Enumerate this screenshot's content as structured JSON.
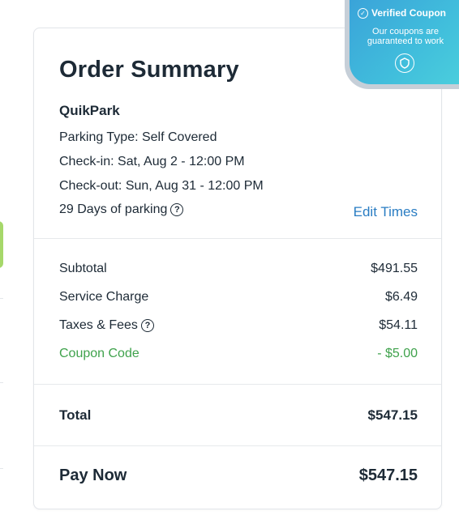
{
  "order": {
    "title": "Order Summary",
    "vendor": "QuikPark",
    "parking_type": "Parking Type: Self Covered",
    "check_in": "Check-in: Sat, Aug 2 - 12:00 PM",
    "check_out": "Check-out: Sun, Aug 31 - 12:00 PM",
    "days": "29 Days of parking",
    "edit_label": "Edit Times"
  },
  "charges": {
    "subtotal_label": "Subtotal",
    "subtotal_value": "$491.55",
    "service_label": "Service Charge",
    "service_value": "$6.49",
    "taxes_label": "Taxes & Fees",
    "taxes_value": "$54.11",
    "coupon_label": "Coupon Code",
    "coupon_value": "- $5.00"
  },
  "total": {
    "label": "Total",
    "value": "$547.15"
  },
  "pay_now": {
    "label": "Pay Now",
    "value": "$547.15"
  },
  "badge": {
    "title": "Verified Coupon",
    "subtitle": "Our coupons are guaranteed to work"
  },
  "icons": {
    "info": "question-circle-icon",
    "check": "check-circle-icon",
    "badge": "shield-icon"
  },
  "colors": {
    "accent": "#2a7dc3",
    "coupon": "#3fa24c",
    "badge": "#41bfdc"
  }
}
